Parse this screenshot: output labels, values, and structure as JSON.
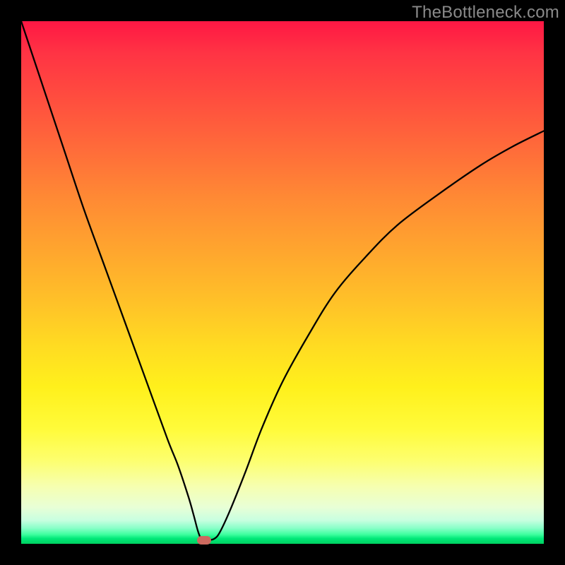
{
  "watermark": "TheBottleneck.com",
  "chart_data": {
    "type": "line",
    "title": "",
    "xlabel": "",
    "ylabel": "",
    "xlim": [
      0,
      100
    ],
    "ylim": [
      0,
      100
    ],
    "grid": false,
    "legend": false,
    "series": [
      {
        "name": "curve",
        "color": "#000000",
        "x": [
          0,
          4,
          8,
          12,
          16,
          20,
          24,
          28,
          30,
          32,
          33,
          33.8,
          34.4,
          35,
          36,
          37,
          38,
          40,
          43,
          46,
          50,
          55,
          60,
          66,
          72,
          80,
          88,
          94,
          100
        ],
        "y": [
          100,
          88,
          76,
          64,
          53,
          42,
          31,
          20,
          15,
          9,
          5.5,
          2.5,
          1.0,
          0.7,
          0.7,
          1.0,
          2.2,
          6.5,
          14,
          22,
          31,
          40,
          48,
          55,
          61,
          67,
          72.5,
          76,
          79
        ]
      }
    ],
    "marker": {
      "x_percent": 35.0,
      "y_percent": 0.7,
      "color": "#cd6a5f"
    }
  }
}
